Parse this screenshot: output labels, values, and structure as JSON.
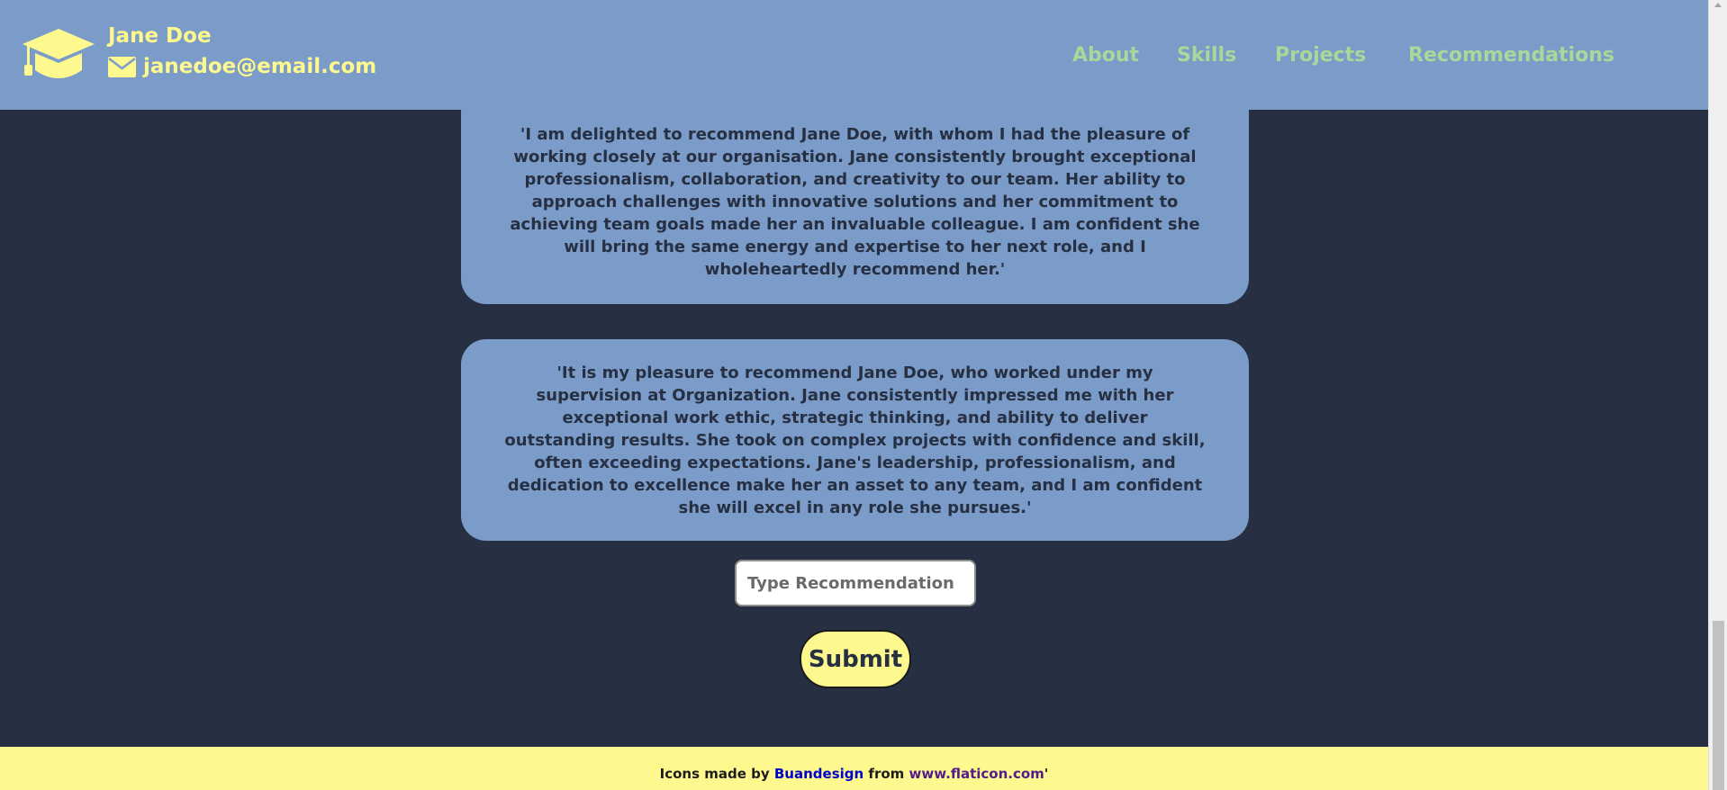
{
  "header": {
    "name": "Jane Doe",
    "email": "janedoe@email.com",
    "logo_icon": "graduation-cap-icon",
    "email_icon": "envelope-icon",
    "nav": [
      "About",
      "Skills",
      "Projects",
      "Recommendations"
    ]
  },
  "recommendations": [
    "'I am delighted to recommend Jane Doe, with whom I had the pleasure of working closely at our organisation. Jane consistently brought exceptional professionalism, collaboration, and creativity to our team. Her ability to approach challenges with innovative solutions and her commitment to achieving team goals made her an invaluable colleague. I am confident she will bring the same energy and expertise to her next role, and I wholeheartedly recommend her.'",
    "'It is my pleasure to recommend Jane Doe, who worked under my supervision at Organization. Jane consistently impressed me with her exceptional work ethic, strategic thinking, and ability to deliver outstanding results. She took on complex projects with confidence and skill, often exceeding expectations. Jane's leadership, professionalism, and dedication to excellence make her an asset to any team, and I am confident she will excel in any role she pursues.'"
  ],
  "form": {
    "placeholder": "Type Recommendation",
    "value": "",
    "submit_label": "Submit"
  },
  "footer": {
    "prefix": "Icons made by ",
    "author": "Buandesign",
    "middle": " from ",
    "site": "www.flaticon.com",
    "suffix": "'"
  },
  "colors": {
    "header_bg": "#7b9cc8",
    "page_bg": "#272f42",
    "accent_yellow": "#fdf98e",
    "nav_green": "#a8d89a"
  }
}
